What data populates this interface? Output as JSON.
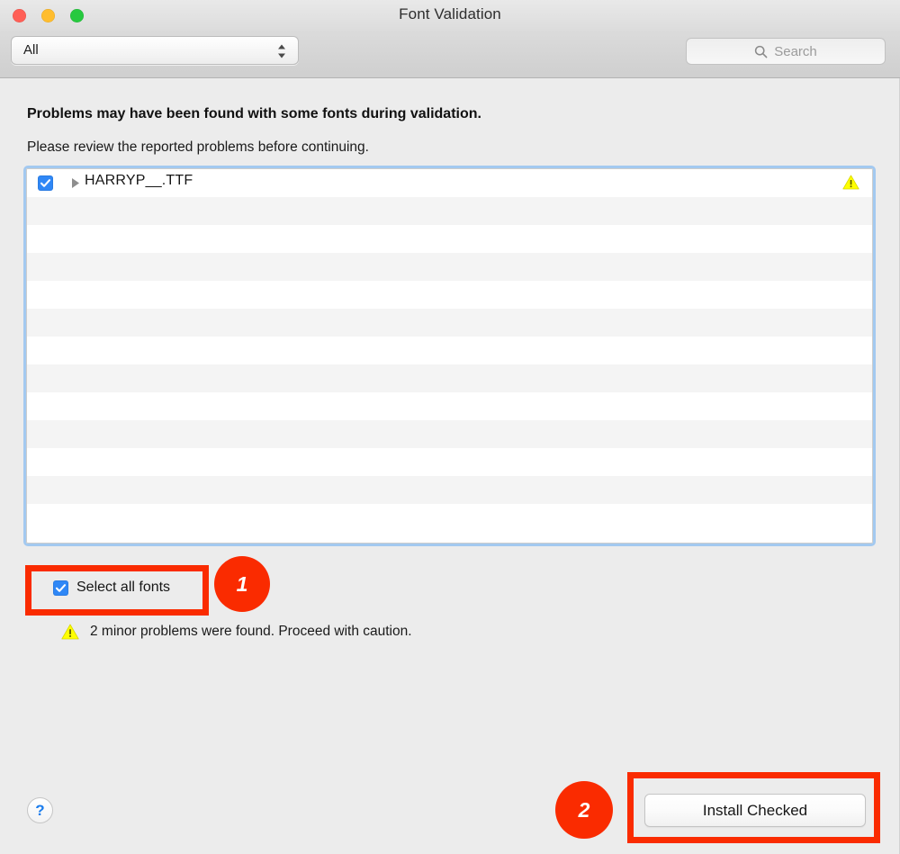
{
  "window": {
    "title": "Font Validation",
    "traffic_lights": [
      "close-button",
      "minimize-button",
      "zoom-button"
    ]
  },
  "toolbar": {
    "filter_selected": "All",
    "filter_options": [
      "All"
    ],
    "search_placeholder": "Search",
    "search_value": "",
    "search_icon": "search-icon",
    "stepper_icon": "up-down-chevron-icon"
  },
  "main": {
    "headline": "Problems may have been found with some fonts during validation.",
    "subhead": "Please review the reported problems before continuing.",
    "list": {
      "rows": [
        {
          "checked": true,
          "disclosure_icon": "disclosure-triangle-icon",
          "label": "HARRYP__.TTF",
          "status_icon": "warning-triangle-icon"
        }
      ],
      "empty_row_count": 12
    },
    "select_all": {
      "label": "Select all fonts",
      "checked": true
    },
    "problem_summary": {
      "icon": "warning-triangle-icon",
      "text": "2 minor problems were found. Proceed with caution."
    },
    "help_label": "?",
    "install_button_label": "Install Checked"
  },
  "annotations": {
    "color": "#fa2b00",
    "badges": [
      {
        "number": "1",
        "target": "select-all-fonts-checkbox"
      },
      {
        "number": "2",
        "target": "install-checked-button"
      }
    ]
  }
}
